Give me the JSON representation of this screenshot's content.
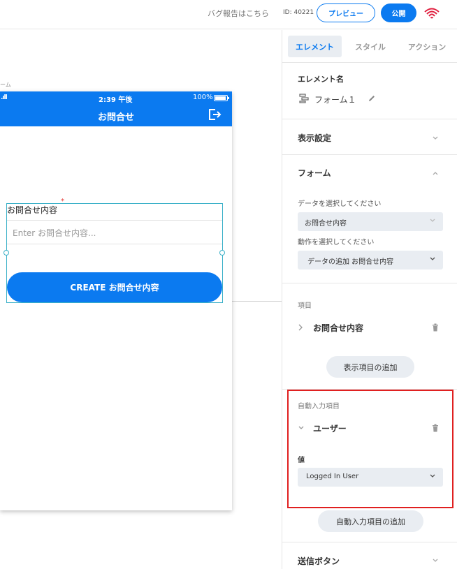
{
  "topbar": {
    "bug_report_link": "バグ報告はこちら",
    "app_id": "ID: 40221",
    "preview_button": "プレビュー",
    "publish_button": "公開",
    "logo_icon": "fingerprint-wifi-icon"
  },
  "canvas": {
    "screen_label": "ーム",
    "phone": {
      "status_time": "2:39 午後",
      "status_battery": "100%",
      "title": "お問合せ",
      "form": {
        "required_mark": "*",
        "field_label": "お問合せ内容",
        "input_placeholder": "Enter お問合せ内容...",
        "submit_button": "CREATE お問合せ内容"
      }
    }
  },
  "panel": {
    "tabs": [
      {
        "label": "エレメント",
        "active": true
      },
      {
        "label": "スタイル",
        "active": false
      },
      {
        "label": "アクション",
        "active": false
      }
    ],
    "element_name": {
      "heading": "エレメント名",
      "value": "フォーム１"
    },
    "display_settings": {
      "title": "表示設定"
    },
    "form_section": {
      "title": "フォーム",
      "data_label": "データを選択してください",
      "data_value": "お問合せ内容",
      "action_label": "動作を選択してください",
      "action_value": "データの追加 お問合せ内容"
    },
    "items_section": {
      "title": "項目",
      "item_name": "お問合せ内容",
      "add_button": "表示項目の追加"
    },
    "auto_input_section": {
      "title": "自動入力項目",
      "item_name": "ユーザー",
      "value_label": "値",
      "value_select": "Logged In User",
      "add_button": "自動入力項目の追加"
    },
    "submit_button_section": {
      "title": "送信ボタン"
    }
  },
  "colors": {
    "accent": "#0b7af0",
    "highlight": "#e02020",
    "selection": "#3ab0c8",
    "panel_gray": "#e9edf2"
  }
}
